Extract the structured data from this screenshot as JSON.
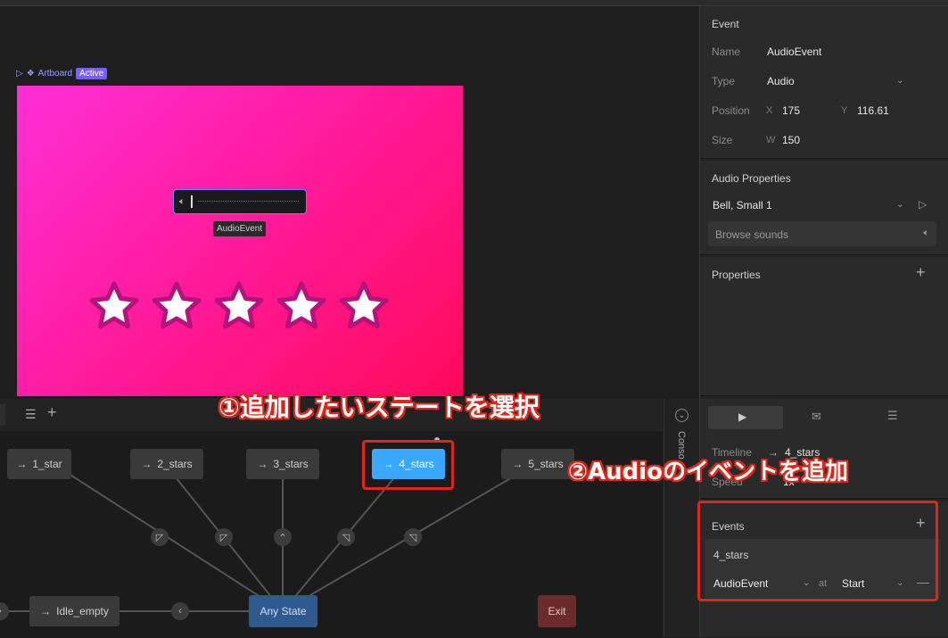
{
  "artboard": {
    "label": "Artboard",
    "badge": "Active",
    "audio_tag": "AudioEvent",
    "star_count": 5
  },
  "event_panel": {
    "title": "Event",
    "name_label": "Name",
    "name_value": "AudioEvent",
    "type_label": "Type",
    "type_value": "Audio",
    "position_label": "Position",
    "x_label": "X",
    "x_value": "175",
    "y_label": "Y",
    "y_value": "116.61",
    "size_label": "Size",
    "w_label": "W",
    "w_value": "150"
  },
  "audio_properties": {
    "title": "Audio Properties",
    "sound_value": "Bell, Small 1",
    "browse_label": "Browse sounds"
  },
  "properties": {
    "title": "Properties"
  },
  "timeline_panel": {
    "timeline_label": "Timeline",
    "timeline_value": "4_stars",
    "speed_label": "Speed",
    "speed_value": "1x"
  },
  "events_panel": {
    "title": "Events",
    "item_name": "4_stars",
    "event_value": "AudioEvent",
    "at_label": "at",
    "start_value": "Start"
  },
  "console": {
    "label": "Conso"
  },
  "state_machine": {
    "states": [
      {
        "label": "1_star"
      },
      {
        "label": "2_stars"
      },
      {
        "label": "3_stars"
      },
      {
        "label": "4_stars"
      },
      {
        "label": "5_stars"
      }
    ],
    "idle_label": "Idle_empty",
    "any_state_label": "Any State",
    "exit_label": "Exit",
    "arrow_glyph": "→"
  },
  "annotations": {
    "step1": "①追加したいステートを選択",
    "step2": "②Audioのイベントを追加"
  },
  "colors": {
    "selected_state": "#3aa8ff",
    "any_state": "#2f5a8f",
    "exit": "#6b2b2b",
    "annotation": "#e0261b"
  }
}
